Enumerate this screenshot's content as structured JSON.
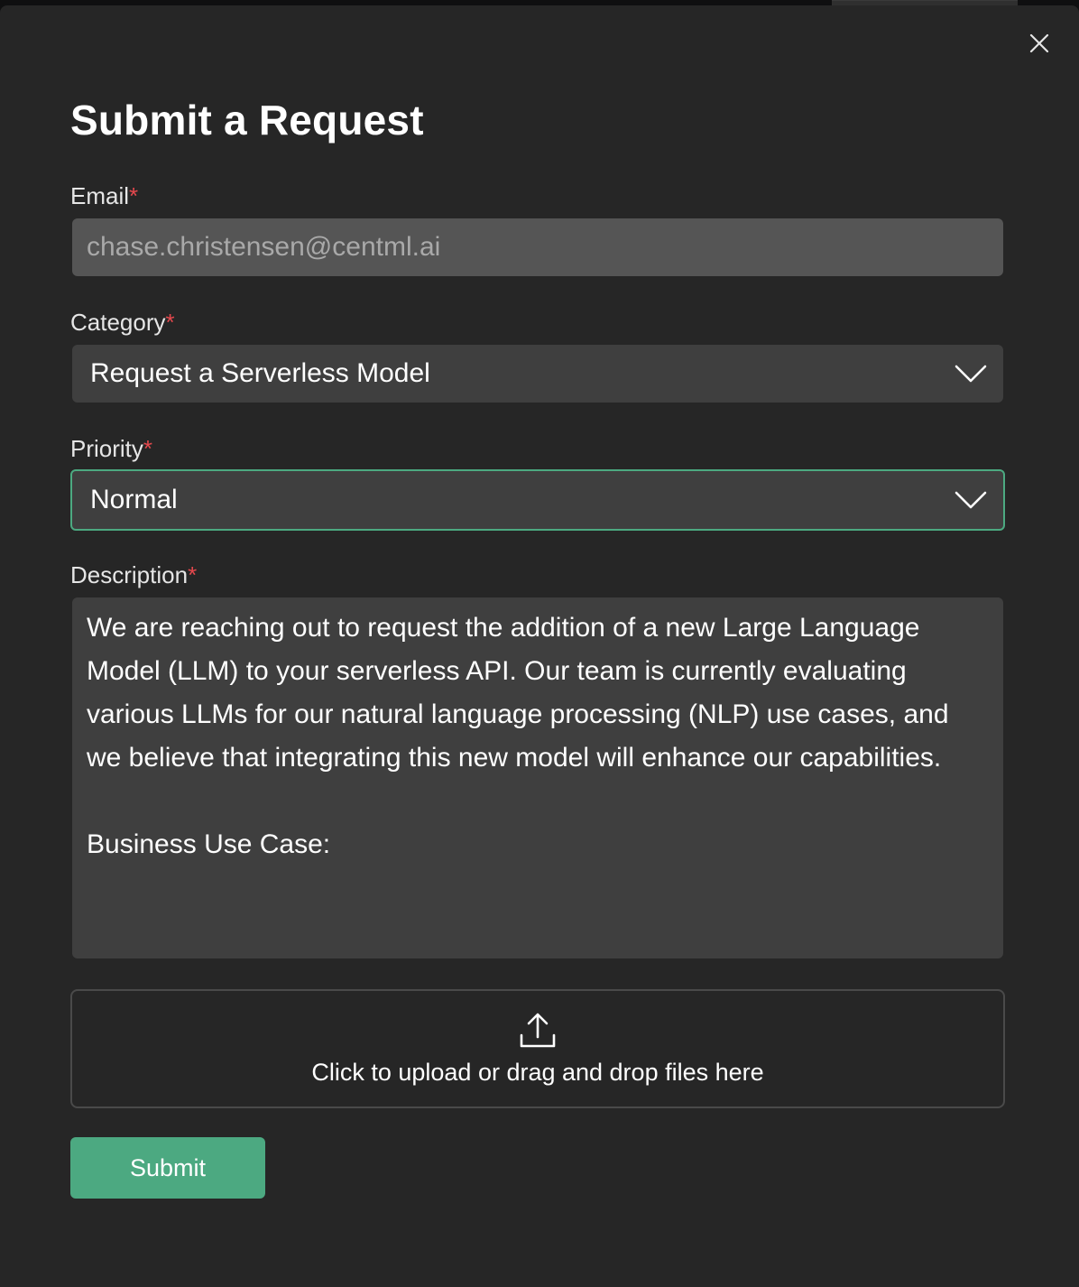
{
  "modal": {
    "title": "Submit a Request",
    "close_icon": "close-icon"
  },
  "form": {
    "required_marker": "*",
    "email": {
      "label": "Email",
      "value": "chase.christensen@centml.ai"
    },
    "category": {
      "label": "Category",
      "selected": "Request a Serverless Model",
      "icon": "chevron-down-icon"
    },
    "priority": {
      "label": "Priority",
      "selected": "Normal",
      "icon": "chevron-down-icon",
      "focus_color": "#4ca981"
    },
    "description": {
      "label": "Description",
      "value": "We are reaching out to request the addition of a new Large Language Model (LLM) to your serverless API. Our team is currently evaluating various LLMs for our natural language processing (NLP) use cases, and we believe that integrating this new model will enhance our capabilities.\n\nBusiness Use Case:"
    },
    "upload": {
      "icon": "upload-icon",
      "text": "Click to upload or drag and drop files here"
    },
    "submit_label": "Submit"
  },
  "colors": {
    "background": "#262626",
    "accent": "#4ca981",
    "required": "#e5484d"
  }
}
